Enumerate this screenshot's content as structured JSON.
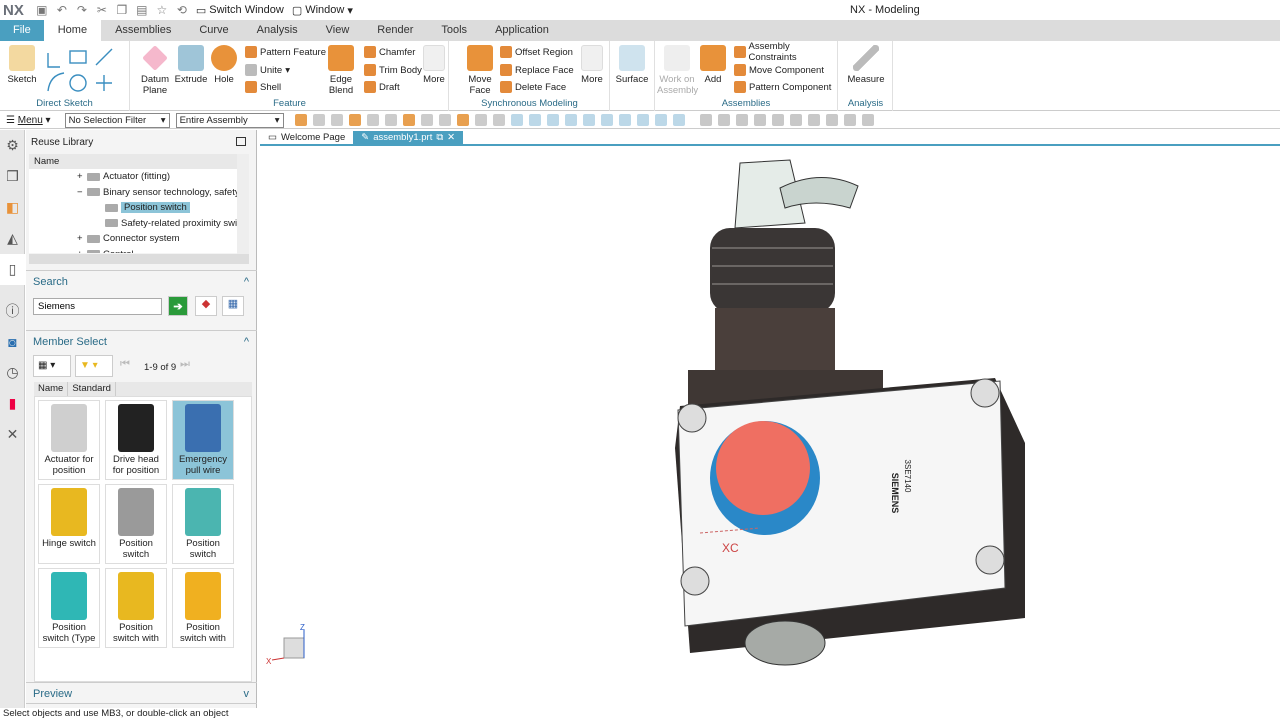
{
  "titlebar": {
    "logo": "NX",
    "switch_window": "Switch Window",
    "window": "Window",
    "title": "NX - Modeling"
  },
  "tabs": [
    "File",
    "Home",
    "Assemblies",
    "Curve",
    "Analysis",
    "View",
    "Render",
    "Tools",
    "Application"
  ],
  "ribbon": {
    "direct_sketch": {
      "label": "Direct Sketch",
      "sketch": "Sketch"
    },
    "feature": {
      "label": "Feature",
      "datum": "Datum Plane",
      "extrude": "Extrude",
      "hole": "Hole",
      "pattern": "Pattern Feature",
      "unite": "Unite",
      "shell": "Shell",
      "edge_blend": "Edge Blend",
      "chamfer": "Chamfer",
      "trim": "Trim Body",
      "draft": "Draft",
      "more": "More"
    },
    "sync": {
      "label": "Synchronous Modeling",
      "move_face": "Move Face",
      "offset": "Offset Region",
      "replace": "Replace Face",
      "delete": "Delete Face",
      "more": "More"
    },
    "surface": "Surface",
    "assemblies": {
      "label": "Assemblies",
      "work": "Work on Assembly",
      "add": "Add",
      "constraints": "Assembly Constraints",
      "move": "Move Component",
      "pattern": "Pattern Component"
    },
    "analysis": {
      "label": "Analysis",
      "measure": "Measure"
    }
  },
  "toolbar": {
    "menu": "Menu",
    "filter": "No Selection Filter",
    "scope": "Entire Assembly"
  },
  "panel": {
    "title": "Reuse Library",
    "col_name": "Name",
    "tree": [
      {
        "t": "Actuator (fitting)",
        "d": 1,
        "s": "+"
      },
      {
        "t": "Binary sensor technology, safety-",
        "d": 1,
        "s": "−"
      },
      {
        "t": "Position switch",
        "d": 2,
        "s": "",
        "sel": true
      },
      {
        "t": "Safety-related proximity switc",
        "d": 2,
        "s": ""
      },
      {
        "t": "Connector system",
        "d": 1,
        "s": "+"
      },
      {
        "t": "Control",
        "d": 1,
        "s": "+"
      }
    ],
    "search": {
      "label": "Search",
      "value": "Siemens"
    },
    "member": {
      "label": "Member Select",
      "count": "1-9 of 9",
      "col_name": "Name",
      "col_standard": "Standard"
    },
    "items": [
      {
        "l": "Actuator for position",
        "c": "#cfcfcf"
      },
      {
        "l": "Drive head for position",
        "c": "#222222"
      },
      {
        "l": "Emergency pull wire",
        "c": "#3a6fb0",
        "sel": true
      },
      {
        "l": "Hinge switch",
        "c": "#e8b820"
      },
      {
        "l": "Position switch",
        "c": "#9a9a9a"
      },
      {
        "l": "Position switch",
        "c": "#4bb5b0"
      },
      {
        "l": "Position switch (Type",
        "c": "#2fb7b5"
      },
      {
        "l": "Position switch with",
        "c": "#e8b820"
      },
      {
        "l": "Position switch with",
        "c": "#f0b020"
      }
    ],
    "preview": "Preview"
  },
  "viewport": {
    "tabs": [
      "Welcome Page",
      "assembly1.prt"
    ],
    "axis_xc": "XC",
    "brand": "SIEMENS",
    "model": "3SE7140",
    "triad": {
      "z": "Z",
      "x": "X"
    }
  },
  "status": "Select objects and use MB3, or double-click an object",
  "colors": {
    "accent": "#4a9fc0",
    "selection": "#8cc4d8",
    "button_red": "#ef6f62",
    "button_blue": "#2a88c8"
  }
}
